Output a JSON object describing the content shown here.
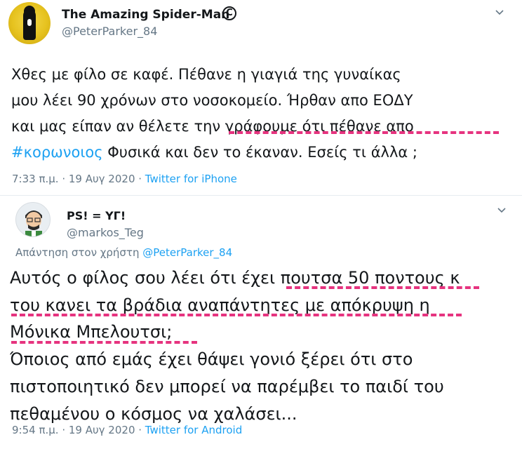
{
  "tweet1": {
    "display_name": "The Amazing Spider-Man",
    "badge": "C",
    "handle": "@PeterParker_84",
    "lines": [
      "Χθες με φίλο σε καφέ. Πέθανε η γιαγιά της γυναίκας",
      "μου λέει 90 χρόνων στο νοσοκομείο. Ήρθαν απο ΕΟΔΥ",
      "και μας είπαν αν θέλετε την γράφουμε ότι πέθανε απο"
    ],
    "hashtag": "#κορωνοιος",
    "last_line_rest": " Φυσικά και δεν το έκαναν. Εσείς τι άλλα ;",
    "time": "7:33 π.μ. · 19 Αυγ 2020 · ",
    "source": "Twitter for iPhone"
  },
  "tweet2": {
    "display_name": "PS! = ΥΓ!",
    "handle": "@markos_Teg",
    "reply_prefix": "Απάντηση στον χρήστη ",
    "reply_to": "@PeterParker_84",
    "lines": [
      "Αυτός ο φίλος σου λέει ότι έχει πουτσα 50 ποντους κ",
      "του κανει τα βράδια αναπάντητες με απόκρυψη η",
      "Μόνικα Μπελουτσι;",
      "Όποιος από εμάς έχει θάψει γονιό ξέρει ότι στο",
      "πιστοποιητικό δεν μπορεί να παρέμβει το παιδί του",
      "πεθαμένου ο κόσμος να χαλάσει..."
    ],
    "time": "9:54 π.μ. · 19 Αυγ 2020 · ",
    "source": "Twitter for Android"
  },
  "colors": {
    "link": "#1da1f2",
    "muted": "#657786",
    "annotation": "#e6337f"
  }
}
